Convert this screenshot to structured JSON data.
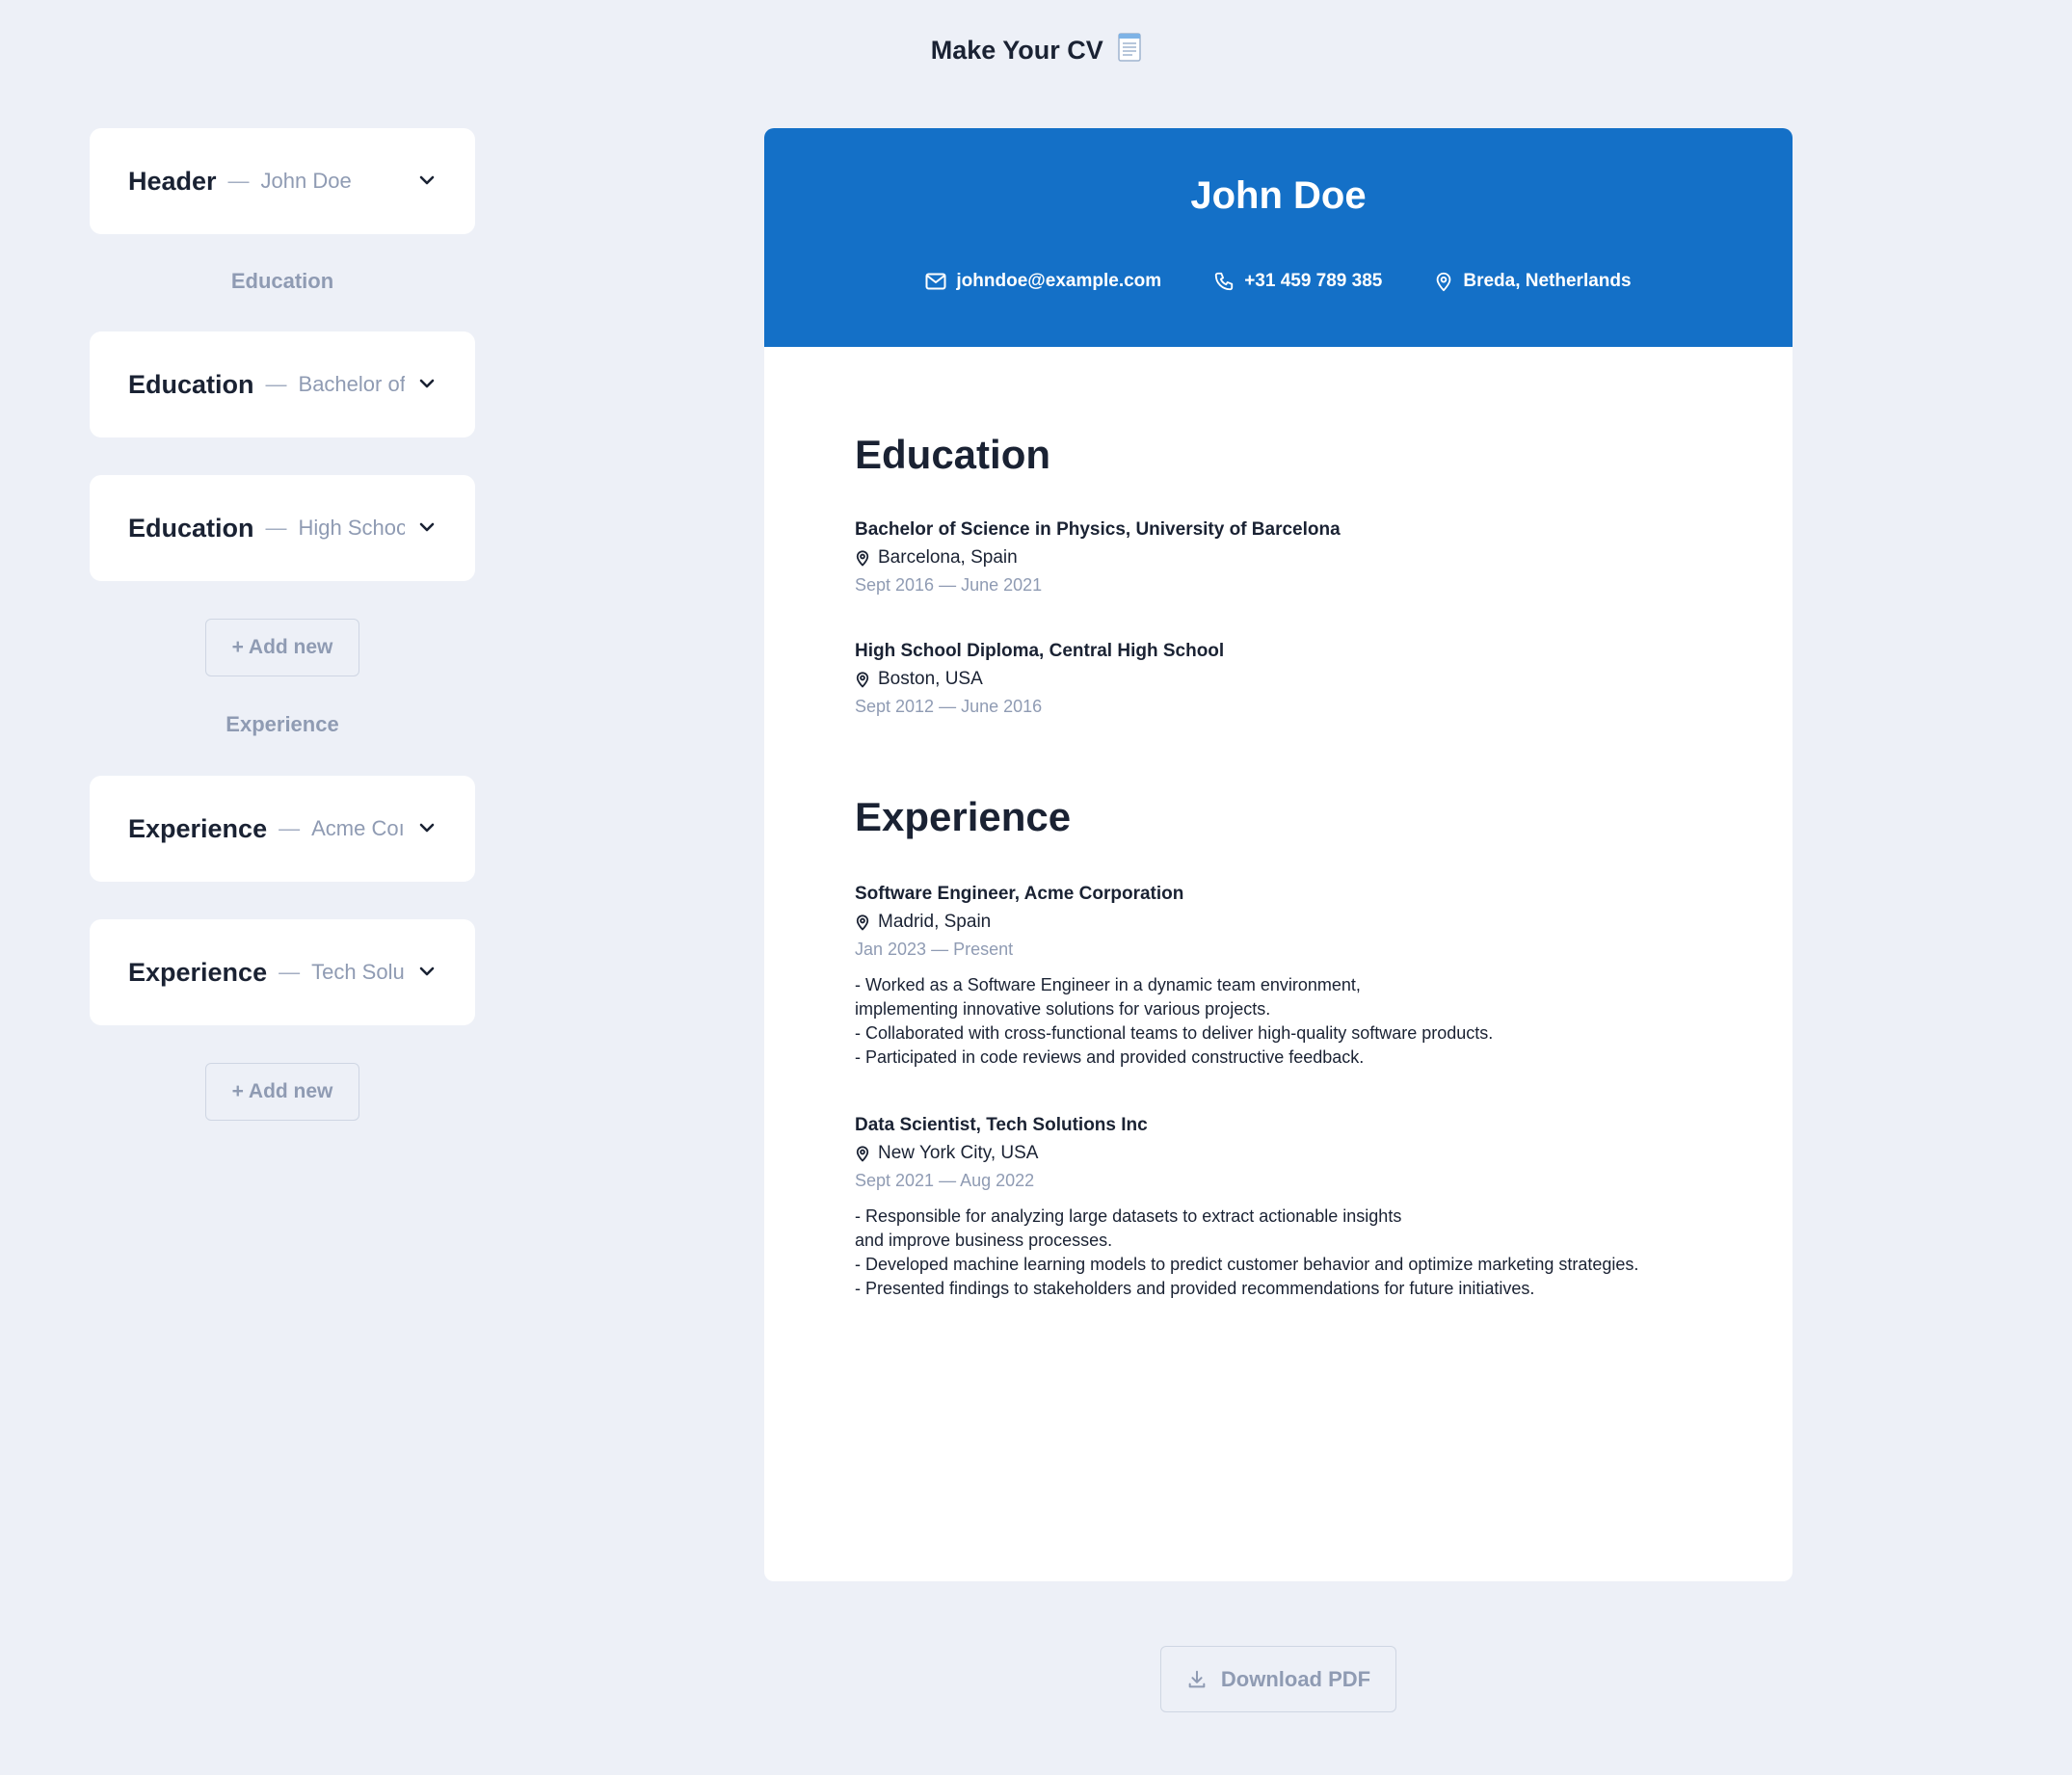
{
  "app": {
    "title": "Make Your CV"
  },
  "sidebar": {
    "header_card": {
      "title": "Header",
      "dash": "—",
      "sub": "John Doe"
    },
    "education_label": "Education",
    "education_cards": [
      {
        "title": "Education",
        "dash": "—",
        "sub": "Bachelor of"
      },
      {
        "title": "Education",
        "dash": "—",
        "sub": "High Schoc"
      }
    ],
    "experience_label": "Experience",
    "experience_cards": [
      {
        "title": "Experience",
        "dash": "—",
        "sub": "Acme Coı"
      },
      {
        "title": "Experience",
        "dash": "—",
        "sub": "Tech Solu"
      }
    ],
    "add_new_label": "+ Add new"
  },
  "cv": {
    "name": "John Doe",
    "email": "johndoe@example.com",
    "phone": "+31 459 789 385",
    "location": "Breda, Netherlands",
    "header_color": "#1470c7",
    "education_heading": "Education",
    "education": [
      {
        "title": "Bachelor of Science in Physics, University of Barcelona",
        "location": "Barcelona, Spain",
        "dates": "Sept 2016 — June 2021"
      },
      {
        "title": "High School Diploma, Central High School",
        "location": "Boston, USA",
        "dates": "Sept 2012 — June 2016"
      }
    ],
    "experience_heading": "Experience",
    "experience": [
      {
        "title": "Software Engineer, Acme Corporation",
        "location": "Madrid, Spain",
        "dates": "Jan 2023 — Present",
        "description": "- Worked as a Software Engineer in a dynamic team environment,\nimplementing innovative solutions for various projects.\n- Collaborated with cross-functional teams to deliver high-quality software products.\n- Participated in code reviews and provided constructive feedback."
      },
      {
        "title": "Data Scientist, Tech Solutions Inc",
        "location": "New York City, USA",
        "dates": "Sept 2021 — Aug 2022",
        "description": "- Responsible for analyzing large datasets to extract actionable insights\nand improve business processes.\n- Developed machine learning models to predict customer behavior and optimize marketing strategies.\n- Presented findings to stakeholders and provided recommendations for future initiatives."
      }
    ]
  },
  "download": {
    "label": "Download PDF"
  }
}
